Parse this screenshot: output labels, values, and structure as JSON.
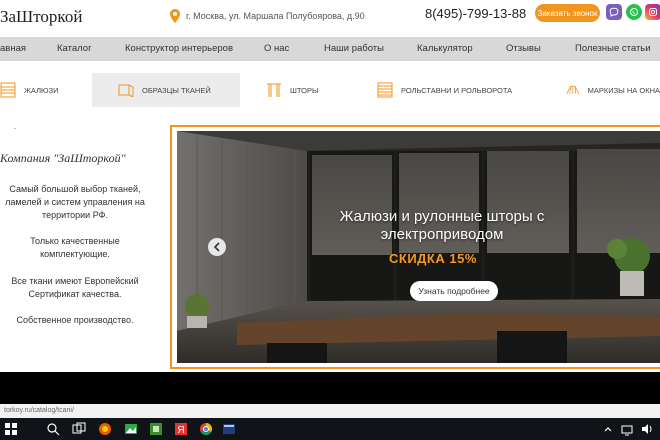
{
  "header": {
    "logo": "ЗаШторкой",
    "address": "г. Москва, ул. Маршала Полубоярова, д.90",
    "phone": "8(495)-799-13-88",
    "call_button": "Заказать звонок",
    "social": [
      "viber-icon",
      "whatsapp-icon",
      "instagram-icon"
    ]
  },
  "nav": {
    "items": [
      "авная",
      "Каталог",
      "Конструктор интерьеров",
      "О нас",
      "Наши работы",
      "Калькулятор",
      "Отзывы",
      "Полезные статьи"
    ]
  },
  "categories": {
    "items": [
      {
        "label": "ЖАЛЮЗИ",
        "icon": "blinds-icon"
      },
      {
        "label": "ОБРАЗЦЫ ТКАНЕЙ",
        "icon": "fabric-samples-icon",
        "active": true
      },
      {
        "label": "ШТОРЫ",
        "icon": "curtains-icon"
      },
      {
        "label": "РОЛЬСТАВНИ И РОЛЬВОРОТА",
        "icon": "shutters-icon"
      },
      {
        "label": "МАРКИЗЫ НА ОКНА",
        "icon": "awning-icon"
      }
    ]
  },
  "sidebar": {
    "dot": ".",
    "company": "Компания \"ЗаШторкой\"",
    "paragraphs": [
      [
        "Самый большой выбор тканей,",
        "ламелей и систем управления на",
        "территории РФ."
      ],
      [
        "Только качественные",
        "комплектующие."
      ],
      [
        "Все ткани имеют Европейский",
        "Сертификат качества."
      ],
      [
        "Собственное производство."
      ]
    ]
  },
  "banner": {
    "headline": [
      "Жалюзи и рулонные шторы с",
      "электроприводом"
    ],
    "discount": "СКИДКА 15%",
    "button": "Узнать подробнее"
  },
  "status_bar": {
    "url": "torkoy.ru/catalog/tcani/"
  },
  "colors": {
    "accent": "#f0951e",
    "nav_bg": "#d8d8d8",
    "discount": "#f39a21"
  }
}
